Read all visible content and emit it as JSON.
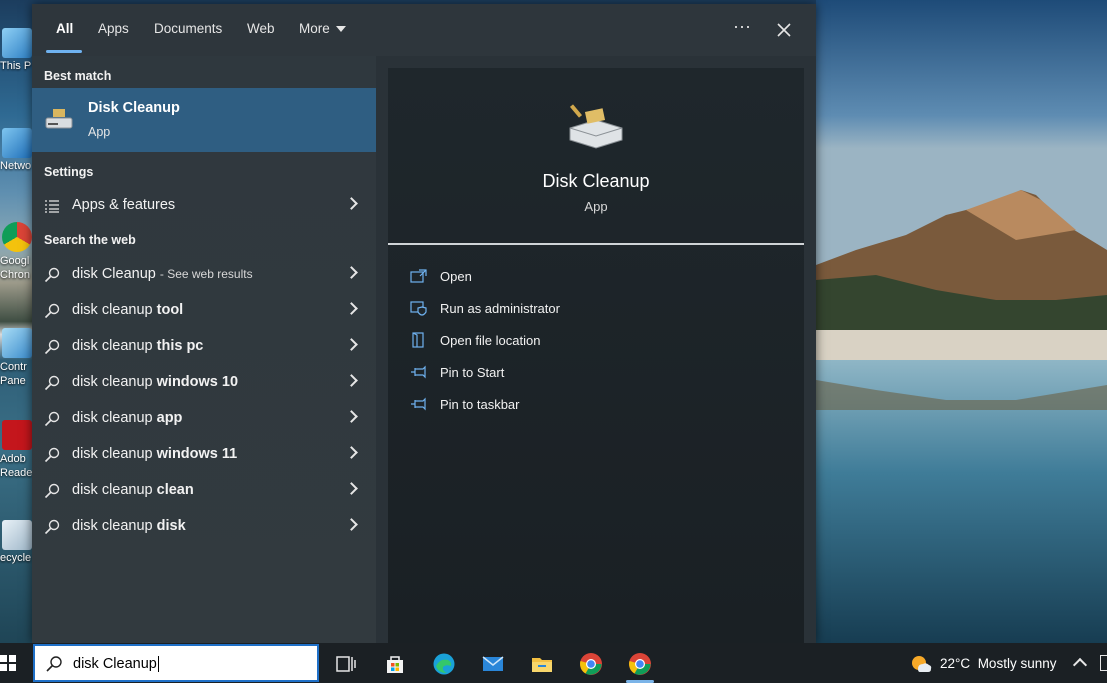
{
  "desktop": {
    "icons": [
      {
        "label": "This P",
        "icon": "computer-icon"
      },
      {
        "label": "Netwo",
        "icon": "network-icon"
      },
      {
        "label": "Googl Chron",
        "icon": "chrome-icon"
      },
      {
        "label": "Contr Pane",
        "icon": "control-panel-icon"
      },
      {
        "label": "Adob Reade",
        "icon": "adobe-reader-icon"
      },
      {
        "label": "ecycle",
        "icon": "recycle-bin-icon"
      }
    ]
  },
  "search_panel": {
    "tabs": [
      {
        "label": "All",
        "active": true
      },
      {
        "label": "Apps"
      },
      {
        "label": "Documents"
      },
      {
        "label": "Web"
      },
      {
        "label": "More"
      }
    ],
    "more_icon": "ellipsis-icon",
    "close_icon": "close-icon",
    "best_match": {
      "heading": "Best match",
      "title": "Disk Cleanup",
      "subtitle": "App",
      "icon": "disk-cleanup-icon"
    },
    "settings": {
      "heading": "Settings",
      "items": [
        {
          "label": "Apps & features",
          "icon": "list-icon"
        }
      ]
    },
    "web": {
      "heading": "Search the web",
      "items": [
        {
          "prefix": "disk Cleanup",
          "suffix": "",
          "note": "- See web results"
        },
        {
          "prefix": "disk cleanup",
          "suffix": "tool",
          "note": ""
        },
        {
          "prefix": "disk cleanup",
          "suffix": "this pc",
          "note": ""
        },
        {
          "prefix": "disk cleanup",
          "suffix": "windows 10",
          "note": ""
        },
        {
          "prefix": "disk cleanup",
          "suffix": "app",
          "note": ""
        },
        {
          "prefix": "disk cleanup",
          "suffix": "windows 11",
          "note": ""
        },
        {
          "prefix": "disk cleanup",
          "suffix": "clean",
          "note": ""
        },
        {
          "prefix": "disk cleanup",
          "suffix": "disk",
          "note": ""
        }
      ]
    },
    "preview": {
      "title": "Disk Cleanup",
      "subtitle": "App",
      "actions": [
        {
          "label": "Open",
          "icon": "open-icon"
        },
        {
          "label": "Run as administrator",
          "icon": "shield-icon"
        },
        {
          "label": "Open file location",
          "icon": "folder-location-icon"
        },
        {
          "label": "Pin to Start",
          "icon": "pin-icon"
        },
        {
          "label": "Pin to taskbar",
          "icon": "pin-icon"
        }
      ]
    }
  },
  "taskbar": {
    "search_value": "disk Cleanup",
    "apps": [
      "task-view-icon",
      "store-icon",
      "edge-icon",
      "mail-icon",
      "file-explorer-icon",
      "chrome-icon",
      "chrome-icon"
    ],
    "weather": {
      "temp": "22°C",
      "condition": "Mostly sunny",
      "icon": "partly-sunny-icon"
    }
  },
  "colors": {
    "accent": "#6fb2f0",
    "selection": "#2f5e82",
    "search_border": "#1f70c8"
  }
}
